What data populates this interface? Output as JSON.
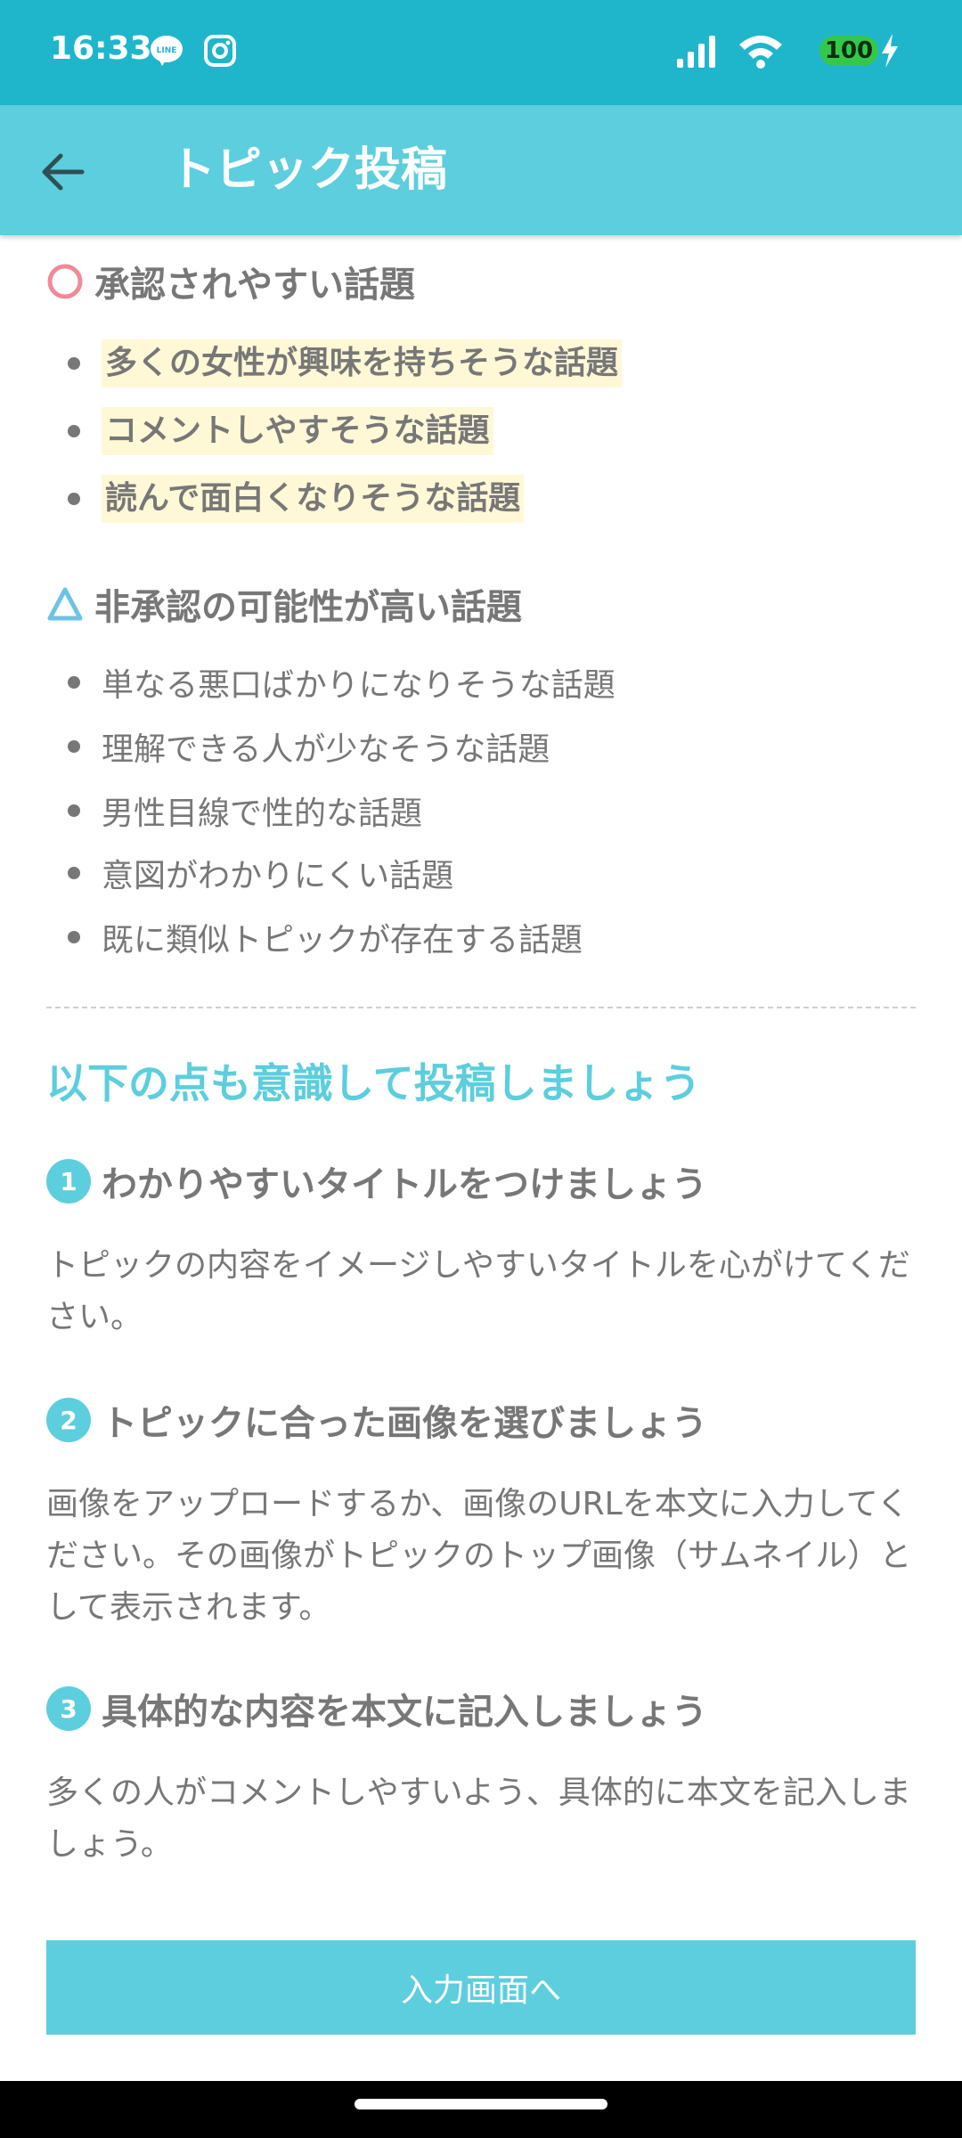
{
  "status_bar": {
    "time": "16:33",
    "battery": "100"
  },
  "app_bar": {
    "title": "トピック投稿"
  },
  "approved_section": {
    "heading": "承認されやすい話題",
    "items": [
      "多くの女性が興味を持ちそうな話題",
      "コメントしやすそうな話題",
      "読んで面白くなりそうな話題"
    ]
  },
  "rejected_section": {
    "heading": "非承認の可能性が高い話題",
    "items": [
      "単なる悪口ばかりになりそうな話題",
      "理解できる人が少なそうな話題",
      "男性目線で性的な話題",
      "意図がわかりにくい話題",
      "既に類似トピックが存在する話題"
    ]
  },
  "tips": {
    "heading": "以下の点も意識して投稿しましょう",
    "items": [
      {
        "number": "1",
        "title": "わかりやすいタイトルをつけましょう",
        "body": "トピックの内容をイメージしやすいタイトルを心がけてください。"
      },
      {
        "number": "2",
        "title": "トピックに合った画像を選びましょう",
        "body": "画像をアップロードするか、画像のURLを本文に入力してください。その画像がトピックのトップ画像（サムネイル）として表示されます。"
      },
      {
        "number": "3",
        "title": "具体的な内容を本文に記入しましょう",
        "body": "多くの人がコメントしやすいよう、具体的に本文を記入しましょう。"
      }
    ]
  },
  "primary_button": {
    "label": "入力画面へ"
  },
  "colors": {
    "status_bar": "#1fb6cc",
    "accent": "#5ccedd",
    "circle_mark": "#f08a96",
    "triangle_mark": "#6cc3e6",
    "highlight": "#fff8d6",
    "battery": "#34c84a"
  }
}
